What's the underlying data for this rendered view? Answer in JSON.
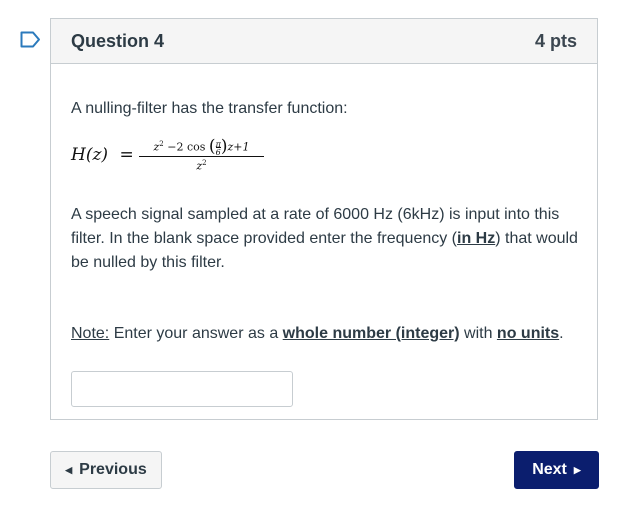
{
  "question": {
    "title": "Question 4",
    "points": "4 pts",
    "intro": "A nulling-filter has the transfer function:",
    "formula": {
      "lhs": "H(z)",
      "numerator": {
        "z2": "z",
        "exp2": "2",
        "minus2": " −2 ",
        "cos": "cos",
        "pi": "π",
        "six": "6",
        "tail": "z+1"
      },
      "denominator": {
        "z": "z",
        "exp": "2"
      }
    },
    "description_before_link": "A speech signal sampled at a rate of 6000 Hz (6kHz) is input into this filter. In the blank space provided enter the frequency (",
    "description_link": "in Hz",
    "description_after_link": ") that would be nulled by this filter.",
    "note": {
      "label": "Note:",
      "text1": " Enter your answer as a ",
      "emph1": "whole number (integer)",
      "text2": " with ",
      "emph2": "no units",
      "text3": "."
    },
    "answer": {
      "value": "",
      "placeholder": ""
    }
  },
  "navigation": {
    "previous_label": "Previous",
    "next_label": "Next"
  },
  "icons": {
    "flag": "bookmark-flag-icon",
    "prev": "triangle-left-icon",
    "next": "triangle-right-icon"
  },
  "colors": {
    "flag": "#2b7abc",
    "next_button": "#0b1e6e",
    "text": "#2d3b45",
    "border": "#c7cdd1",
    "header_bg": "#f5f5f5"
  }
}
